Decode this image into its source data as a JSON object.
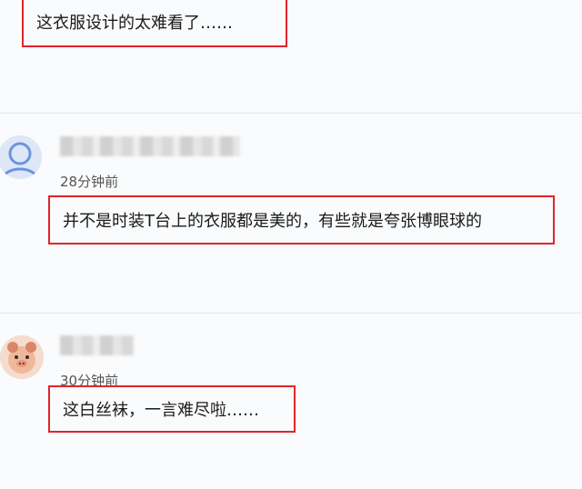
{
  "comments": [
    {
      "text": "这衣服设计的太难看了……"
    },
    {
      "avatar": "default-user-avatar",
      "time": "28分钟前",
      "text": "并不是时装T台上的衣服都是美的，有些就是夸张博眼球的"
    },
    {
      "avatar": "cartoon-pig-avatar",
      "time": "30分钟前",
      "text": "这白丝袜，一言难尽啦……"
    }
  ],
  "colors": {
    "highlight_border": "#e0252b",
    "background": "#fafbfc",
    "divider": "#e6e8ec"
  }
}
